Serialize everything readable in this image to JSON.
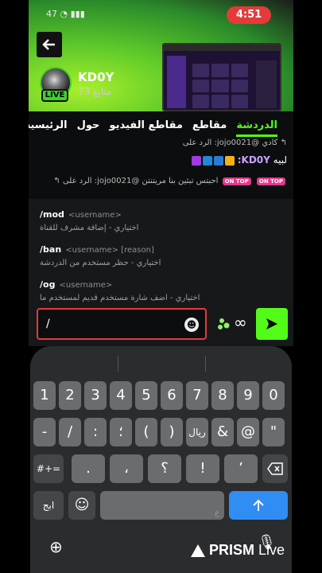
{
  "status": {
    "time": "4:51",
    "left": "47"
  },
  "channel": {
    "name": "KD0Y",
    "followers": "73 متابع",
    "live": "LIVE"
  },
  "tabs": [
    "الدردشة",
    "مقاطع",
    "مقاطع الفيديو",
    "حول",
    "الرئيسية"
  ],
  "chat": {
    "line1": "كادي  @jojo0021: الرد على",
    "line2_user": "KD0Y:",
    "line2_text": "لبيه",
    "line3": "احبتس تبثين بنا مريتنتن  @jojo0021: الرد على",
    "ontop": "ON TOP"
  },
  "commands": [
    {
      "name": "/mod",
      "args": "<username>",
      "desc": "اختياري - إضافة مشرف للقناة"
    },
    {
      "name": "/ban",
      "args": "<username> [reason]",
      "desc": "اختياري - حظر مستخدم من الدردشة"
    },
    {
      "name": "/og",
      "args": "<username>",
      "desc": "اختياري - اضف شارة مستخدم قديم لمستخدم ما"
    }
  ],
  "input": {
    "value": "/"
  },
  "keyboard": {
    "row1": [
      "1",
      "2",
      "3",
      "4",
      "5",
      "6",
      "7",
      "8",
      "9",
      "0"
    ],
    "row2": [
      "-",
      "/",
      ":",
      "؛",
      "(",
      ")",
      "ريال",
      "&",
      "@",
      "\""
    ],
    "row3_mode": "#+=",
    "row3": [
      ".",
      "،",
      "؟",
      "!",
      "’"
    ],
    "row4_lang": "ابج",
    "space_hint": "ع",
    "colors": {
      "key": "#6b6c6e",
      "dark": "#454648",
      "blue": "#2f8df3"
    }
  },
  "watermark": {
    "brand": "PRISM",
    "suffix": "Live"
  },
  "colors": {
    "accent": "#53fc18",
    "live": "#3bd32b",
    "status": "#e53a3a"
  }
}
